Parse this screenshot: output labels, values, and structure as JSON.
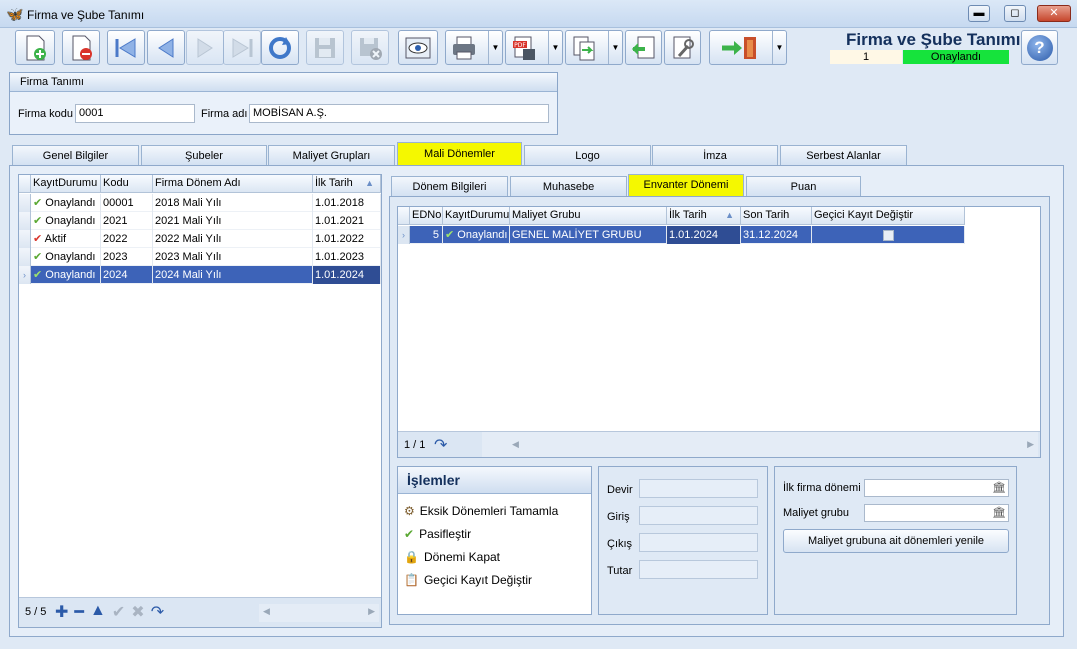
{
  "window": {
    "title": "Firma ve Şube Tanımı",
    "min_icon": "minimize-icon",
    "max_icon": "maximize-icon",
    "close_icon": "close-icon",
    "min_glyph": "▬",
    "max_glyph": "◻",
    "close_glyph": "✕"
  },
  "toolbar": {
    "icons": [
      "new-document-icon",
      "delete-document-icon",
      "first-record-icon",
      "previous-record-icon",
      "next-record-icon",
      "last-record-icon",
      "refresh-icon",
      "save-icon",
      "cancel-save-icon",
      "preview-icon",
      "print-icon",
      "pdf-export-icon",
      "transfer-icon",
      "import-icon",
      "tools-icon",
      "exit-icon"
    ],
    "dropdown_glyph": "▼",
    "pdf_text": "PDF"
  },
  "header": {
    "title": "Firma ve Şube Tanımı",
    "record_no": "1",
    "status": "Onaylandı",
    "status_color": "#16e33c",
    "help_glyph": "?"
  },
  "firma": {
    "group_title": "Firma Tanımı",
    "kod_label": "Firma kodu",
    "kod_value": "0001",
    "ad_label": "Firma adı",
    "ad_value": "MOBİSAN A.Ş."
  },
  "tabs": [
    "Genel Bilgiler",
    "Şubeler",
    "Maliyet Grupları",
    "Mali Dönemler",
    "Logo",
    "İmza",
    "Serbest Alanlar"
  ],
  "active_tab": "Mali Dönemler",
  "period_grid": {
    "columns": [
      "KayıtDurumu",
      "Kodu",
      "Firma Dönem Adı",
      "İlk Tarih"
    ],
    "rows": [
      {
        "status": "Onaylandı",
        "code": "00001",
        "name": "2018 Mali Yılı",
        "date": "1.01.2018",
        "check": "green"
      },
      {
        "status": "Onaylandı",
        "code": "2021",
        "name": "2021 Mali Yılı",
        "date": "1.01.2021",
        "check": "green"
      },
      {
        "status": "Aktif",
        "code": "2022",
        "name": "2022 Mali Yılı",
        "date": "1.01.2022",
        "check": "red"
      },
      {
        "status": "Onaylandı",
        "code": "2023",
        "name": "2023 Mali Yılı",
        "date": "1.01.2023",
        "check": "green"
      },
      {
        "status": "Onaylandı",
        "code": "2024",
        "name": "2024 Mali Yılı",
        "date": "1.01.2024",
        "check": "green"
      }
    ],
    "selected_row": 4,
    "pager": "5 / 5",
    "nav_icons": [
      "add-icon",
      "remove-icon",
      "up-icon",
      "confirm-icon",
      "cancel-icon",
      "refresh-icon"
    ],
    "nav_glyphs": [
      "✚",
      "━",
      "▲",
      "✔",
      "✖",
      "↷"
    ]
  },
  "sub_tabs": [
    "Dönem Bilgileri",
    "Muhasebe",
    "Envanter Dönemi",
    "Puan"
  ],
  "active_sub_tab": "Envanter Dönemi",
  "inventory_grid": {
    "columns": [
      "EDNo",
      "KayıtDurumu",
      "Maliyet Grubu",
      "İlk Tarih",
      "Son Tarih",
      "Geçici Kayıt Değiştir"
    ],
    "rows": [
      {
        "edno": "5",
        "status": "Onaylandı",
        "group": "GENEL MALİYET GRUBU",
        "start": "1.01.2024",
        "end": "31.12.2024",
        "temp": false
      }
    ],
    "pager": "1 / 1"
  },
  "operations": {
    "title": "İşlemler",
    "items": [
      {
        "label": "Eksik Dönemleri Tamamla",
        "icon": "wizard-icon",
        "glyph": "⚙"
      },
      {
        "label": "Pasifleştir",
        "icon": "checkmark-icon",
        "glyph": "✔"
      },
      {
        "label": "Dönemi Kapat",
        "icon": "lock-icon",
        "glyph": "🔒"
      },
      {
        "label": "Geçici Kayıt Değiştir",
        "icon": "edit-record-icon",
        "glyph": "📋"
      }
    ]
  },
  "amounts": {
    "labels": [
      "Devir",
      "Giriş",
      "Çıkış",
      "Tutar"
    ]
  },
  "filters": {
    "ilk_label": "İlk firma dönemi",
    "grup_label": "Maliyet grubu",
    "button": "Maliyet grubuna ait dönemleri yenile",
    "lookup_icon": "lookup-icon",
    "lookup_glyph": "🏛"
  },
  "colors": {
    "selection": "#3d63b8",
    "active_tab": "#f5f800"
  }
}
